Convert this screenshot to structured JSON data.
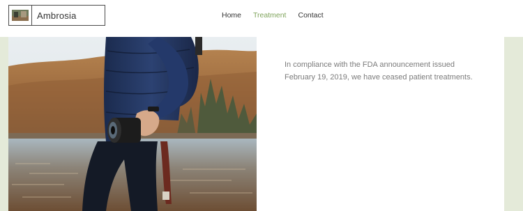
{
  "site": {
    "name": "Ambrosia"
  },
  "nav": {
    "items": [
      {
        "label": "Home",
        "active": false
      },
      {
        "label": "Treatment",
        "active": true
      },
      {
        "label": "Contact",
        "active": false
      }
    ],
    "active_color": "#7ea35a"
  },
  "notice": {
    "line1": "In compliance with the FDA announcement issued",
    "line2": "February 19, 2019, we have ceased patient treatments."
  },
  "hero_image": {
    "icon": "photo-person-holding-camera-by-lake"
  },
  "colors": {
    "page_background": "#e4ead9",
    "panel_background": "#ffffff",
    "text_muted": "#7b7b7b"
  }
}
